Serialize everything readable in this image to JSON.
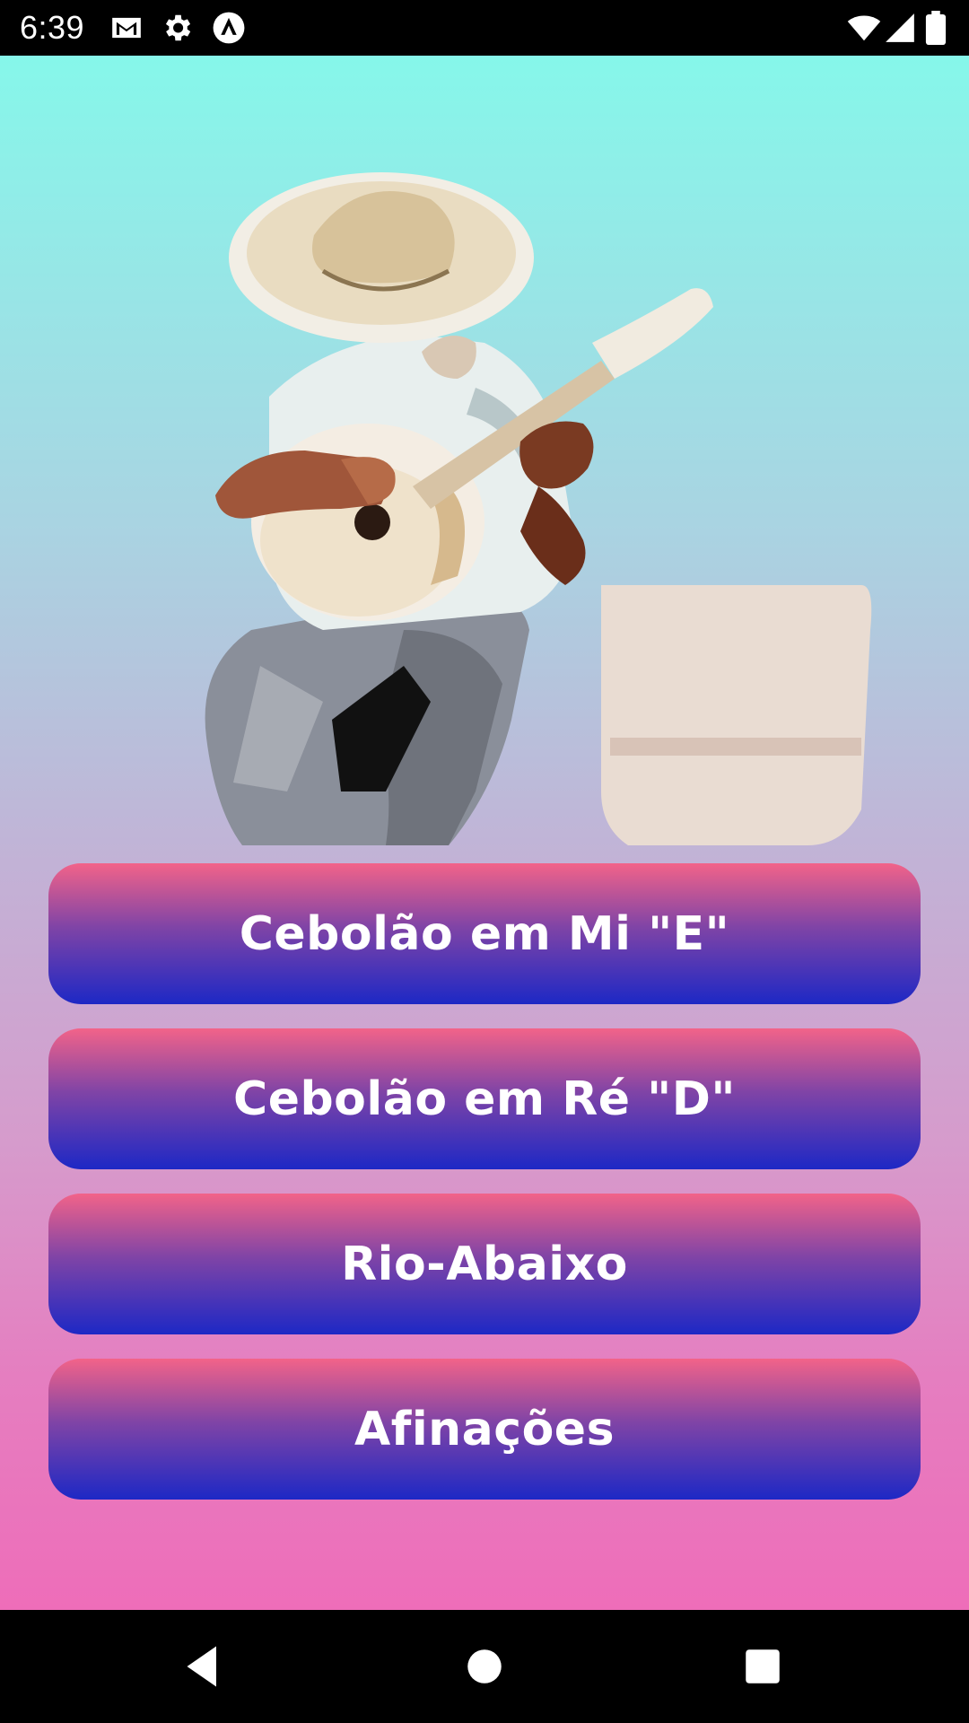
{
  "status_bar": {
    "time": "6:39",
    "icons": [
      "gmail-icon",
      "settings-icon",
      "app-icon",
      "wifi-icon",
      "signal-icon",
      "battery-icon"
    ]
  },
  "illustration": {
    "icon": "guitar-player-illustration"
  },
  "menu": {
    "buttons": [
      {
        "label": "Cebolão em Mi \"E\""
      },
      {
        "label": "Cebolão em Ré \"D\""
      },
      {
        "label": "Rio-Abaixo"
      },
      {
        "label": "Afinações"
      }
    ]
  },
  "nav_bar": {
    "icons": [
      "back-icon",
      "home-icon",
      "recents-icon"
    ]
  },
  "colors": {
    "background_top": "#86f7ea",
    "background_bottom": "#ee6db9",
    "button_top": "#f26389",
    "button_bottom": "#1d28c5",
    "button_text": "#ffffff"
  }
}
